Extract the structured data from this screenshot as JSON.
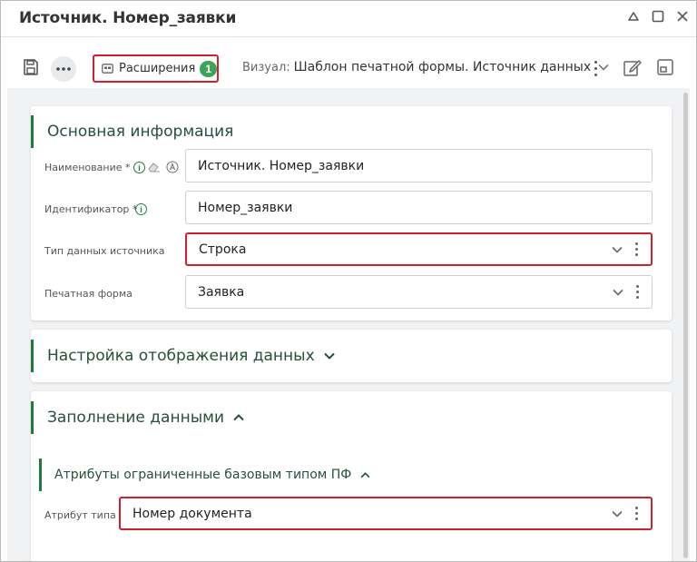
{
  "window": {
    "title": "Источник. Номер_заявки"
  },
  "toolbar": {
    "extensions_label": "Расширения",
    "extensions_count": "1",
    "visual_label": "Визуал:",
    "visual_value": "Шаблон печатной формы. Источник данных"
  },
  "section_main": {
    "title": "Основная информация",
    "name_label": "Наименование *",
    "name_value": "Источник. Номер_заявки",
    "id_label": "Идентификатор *",
    "id_value": "Номер_заявки",
    "source_type_label": "Тип данных источника",
    "source_type_value": "Строка",
    "print_form_label": "Печатная форма",
    "print_form_value": "Заявка"
  },
  "section_display": {
    "title": "Настройка отображения данных"
  },
  "section_fill": {
    "title": "Заполнение данными",
    "subsection_title": "Атрибуты ограниченные базовым типом ПФ",
    "type_attr_label": "Атрибут типа",
    "type_attr_value": "Номер документа"
  },
  "colors": {
    "accent": "#1f7a3c",
    "highlight": "#d0202f",
    "badge": "#3ca45a"
  }
}
